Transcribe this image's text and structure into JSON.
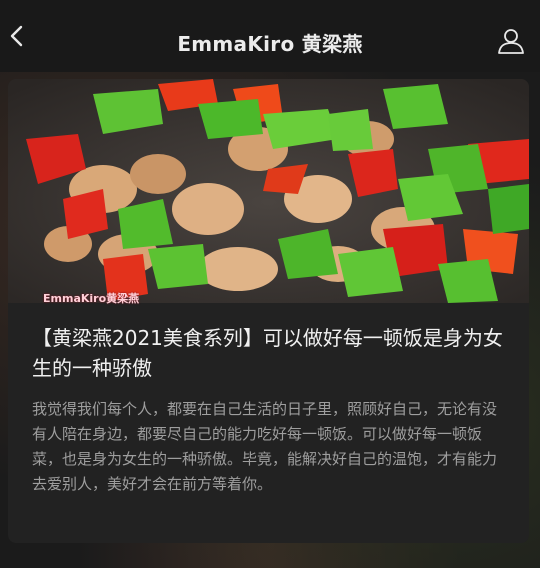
{
  "nav": {
    "title": "EmmaKiro 黄梁燕",
    "back_icon": "chevron-left-icon",
    "profile_icon": "person-icon"
  },
  "article": {
    "cover_watermark": "EmmaKiro黄梁燕",
    "title": "【黄梁燕2021美食系列】可以做好每一顿饭是身为女生的一种骄傲",
    "description": "我觉得我们每个人，都要在自己生活的日子里，照顾好自己，无论有没有人陪在身边，都要尽自己的能力吃好每一顿饭。可以做好每一顿饭菜，也是身为女生的一种骄傲。毕竟，能解决好自己的温饱，才有能力去爱别人，美好才会在前方等着你。"
  },
  "colors": {
    "nav_bg": "#191919",
    "card_bg": "#222222",
    "title_text": "#f0f0f0",
    "desc_text": "#9e9e9e"
  }
}
